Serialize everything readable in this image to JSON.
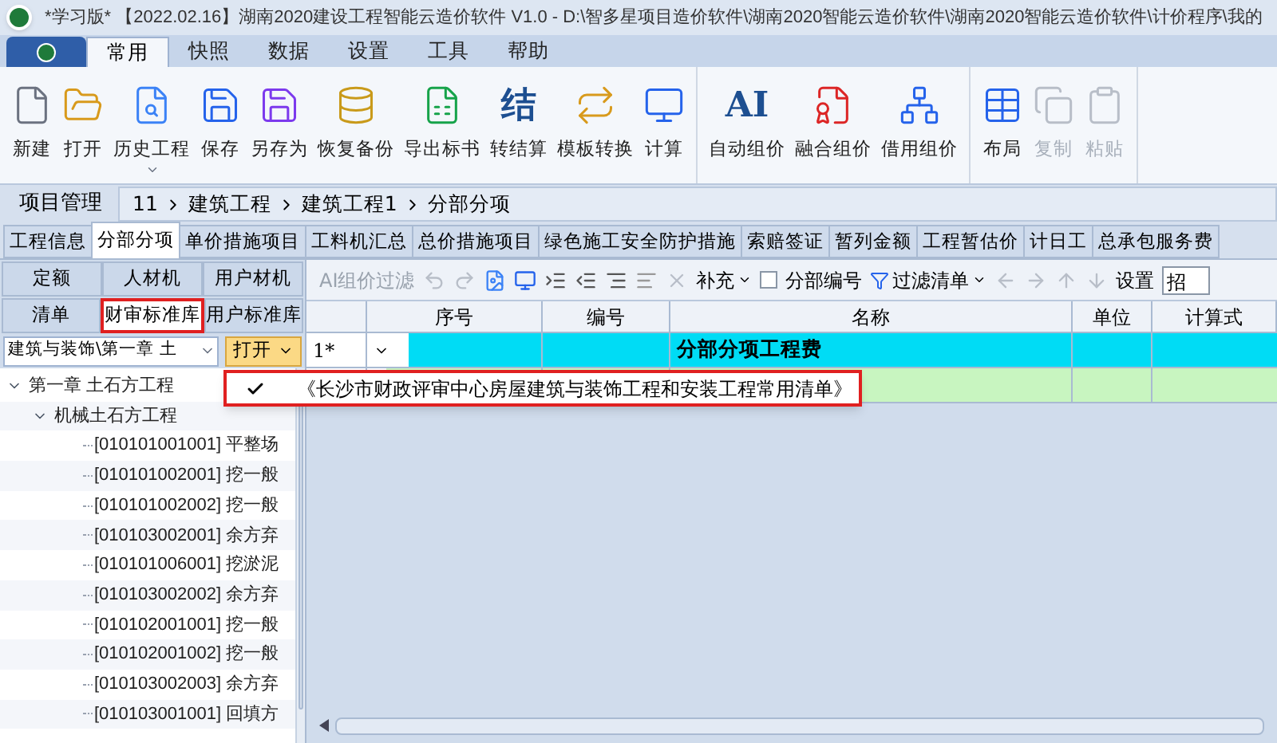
{
  "window": {
    "title": "*学习版* 【2022.02.16】湖南2020建设工程智能云造价软件 V1.0 - D:\\智多星项目造价软件\\湖南2020智能云造价软件\\湖南2020智能云造价软件\\计价程序\\我的"
  },
  "menu_tabs": [
    {
      "label": "常用",
      "selected": true
    },
    {
      "label": "快照",
      "selected": false
    },
    {
      "label": "数据",
      "selected": false
    },
    {
      "label": "设置",
      "selected": false
    },
    {
      "label": "工具",
      "selected": false
    },
    {
      "label": "帮助",
      "selected": false
    }
  ],
  "ribbon_groups": [
    [
      {
        "label": "新建",
        "disabled": false
      },
      {
        "label": "打开",
        "disabled": false
      },
      {
        "label": "历史工程",
        "disabled": false,
        "dropdown": true
      },
      {
        "label": "保存",
        "disabled": false
      },
      {
        "label": "另存为",
        "disabled": false
      },
      {
        "label": "恢复备份",
        "disabled": false
      },
      {
        "label": "导出标书",
        "disabled": false
      },
      {
        "label": "转结算",
        "disabled": false,
        "glyph": "结"
      },
      {
        "label": "模板转换",
        "disabled": false
      },
      {
        "label": "计算",
        "disabled": false
      }
    ],
    [
      {
        "label": "自动组价",
        "disabled": false,
        "glyph": "AI"
      },
      {
        "label": "融合组价",
        "disabled": false
      },
      {
        "label": "借用组价",
        "disabled": false
      }
    ],
    [
      {
        "label": "布局",
        "disabled": false
      },
      {
        "label": "复制",
        "disabled": true
      },
      {
        "label": "粘贴",
        "disabled": true
      }
    ]
  ],
  "project_label": "项目管理",
  "breadcrumb": [
    "11",
    "建筑工程",
    "建筑工程1",
    "分部分项"
  ],
  "page_tabs": [
    {
      "label": "工程信息",
      "selected": false
    },
    {
      "label": "分部分项",
      "selected": true
    },
    {
      "label": "单价措施项目",
      "selected": false
    },
    {
      "label": "工料机汇总",
      "selected": false
    },
    {
      "label": "总价措施项目",
      "selected": false
    },
    {
      "label": "绿色施工安全防护措施",
      "selected": false
    },
    {
      "label": "索赔签证",
      "selected": false
    },
    {
      "label": "暂列金额",
      "selected": false
    },
    {
      "label": "工程暂估价",
      "selected": false
    },
    {
      "label": "计日工",
      "selected": false
    },
    {
      "label": "总承包服务费",
      "selected": false
    }
  ],
  "library_tabs": [
    [
      {
        "label": "定额",
        "selected": false
      },
      {
        "label": "人材机",
        "selected": false
      },
      {
        "label": "用户材机",
        "selected": false
      }
    ],
    [
      {
        "label": "清单",
        "selected": false
      },
      {
        "label": "财审标准库",
        "selected": true
      },
      {
        "label": "用户标准库",
        "selected": false
      }
    ]
  ],
  "library_select": {
    "value": "建筑与装饰\\第一章  土"
  },
  "open_button": "打开",
  "tree": [
    {
      "label": "第一章  土石方工程",
      "expanded": true,
      "children": [
        {
          "label": "机械土石方工程",
          "expanded": true,
          "children": [
            {
              "label": "[010101001001] 平整场"
            },
            {
              "label": "[010101002001] 挖一般"
            },
            {
              "label": "[010101002002] 挖一般"
            },
            {
              "label": "[010103002001] 余方弃"
            },
            {
              "label": "[010101006001] 挖淤泥"
            },
            {
              "label": "[010103002002] 余方弃"
            },
            {
              "label": "[010102001001] 挖一般"
            },
            {
              "label": "[010102001002] 挖一般"
            },
            {
              "label": "[010103002003] 余方弃"
            },
            {
              "label": "[010103001001] 回填方"
            }
          ]
        }
      ]
    }
  ],
  "toolbar": {
    "ai_filter": "AI组价过滤",
    "supplement": "补充",
    "section_code": {
      "label": "分部编号",
      "checked": false
    },
    "filter_list": "过滤清单",
    "settings": "设置",
    "field_value": "招"
  },
  "table": {
    "columns": [
      "序号",
      "编号",
      "名称",
      "单位",
      "计算式"
    ],
    "rows": [
      {
        "row_header": "1*",
        "name": "分部分项工程费",
        "expanded": true,
        "color": "#00dcf5"
      },
      {
        "color": "#c8f5c0"
      }
    ]
  },
  "popup_menu": [
    {
      "label": "《长沙市财政评审中心房屋建筑与装饰工程和安装工程常用清单》",
      "checked": true
    }
  ]
}
